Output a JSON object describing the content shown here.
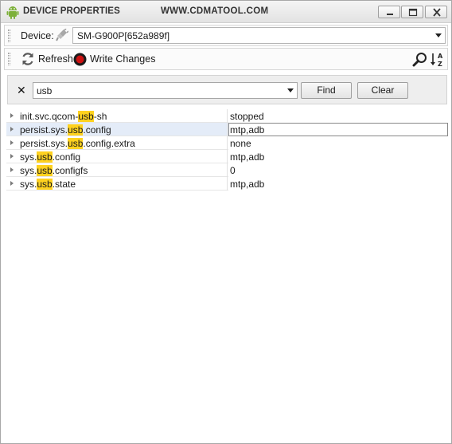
{
  "window": {
    "title": "DEVICE PROPERTIES",
    "site": "WWW.CDMATOOL.COM",
    "icon": "android-icon"
  },
  "device": {
    "label": "Device:",
    "selected": "SM-G900P[652a989f]"
  },
  "toolbar": {
    "refresh_label": "Refresh",
    "write_label": "Write Changes"
  },
  "search": {
    "value": "usb",
    "find_label": "Find",
    "clear_label": "Clear"
  },
  "properties": [
    {
      "key_pre": "init.svc.qcom-",
      "key_match": "usb",
      "key_post": "-sh",
      "value": "stopped"
    },
    {
      "key_pre": "persist.sys.",
      "key_match": "usb",
      "key_post": ".config",
      "value": "mtp,adb"
    },
    {
      "key_pre": "persist.sys.",
      "key_match": "usb",
      "key_post": ".config.extra",
      "value": "none"
    },
    {
      "key_pre": "sys.",
      "key_match": "usb",
      "key_post": ".config",
      "value": "mtp,adb"
    },
    {
      "key_pre": "sys.",
      "key_match": "usb",
      "key_post": ".configfs",
      "value": "0"
    },
    {
      "key_pre": "sys.",
      "key_match": "usb",
      "key_post": ".state",
      "value": "mtp,adb"
    }
  ],
  "colors": {
    "highlight": "#ffd21f",
    "selected_row": "#e4ecf8",
    "record_red": "#cc1111"
  }
}
